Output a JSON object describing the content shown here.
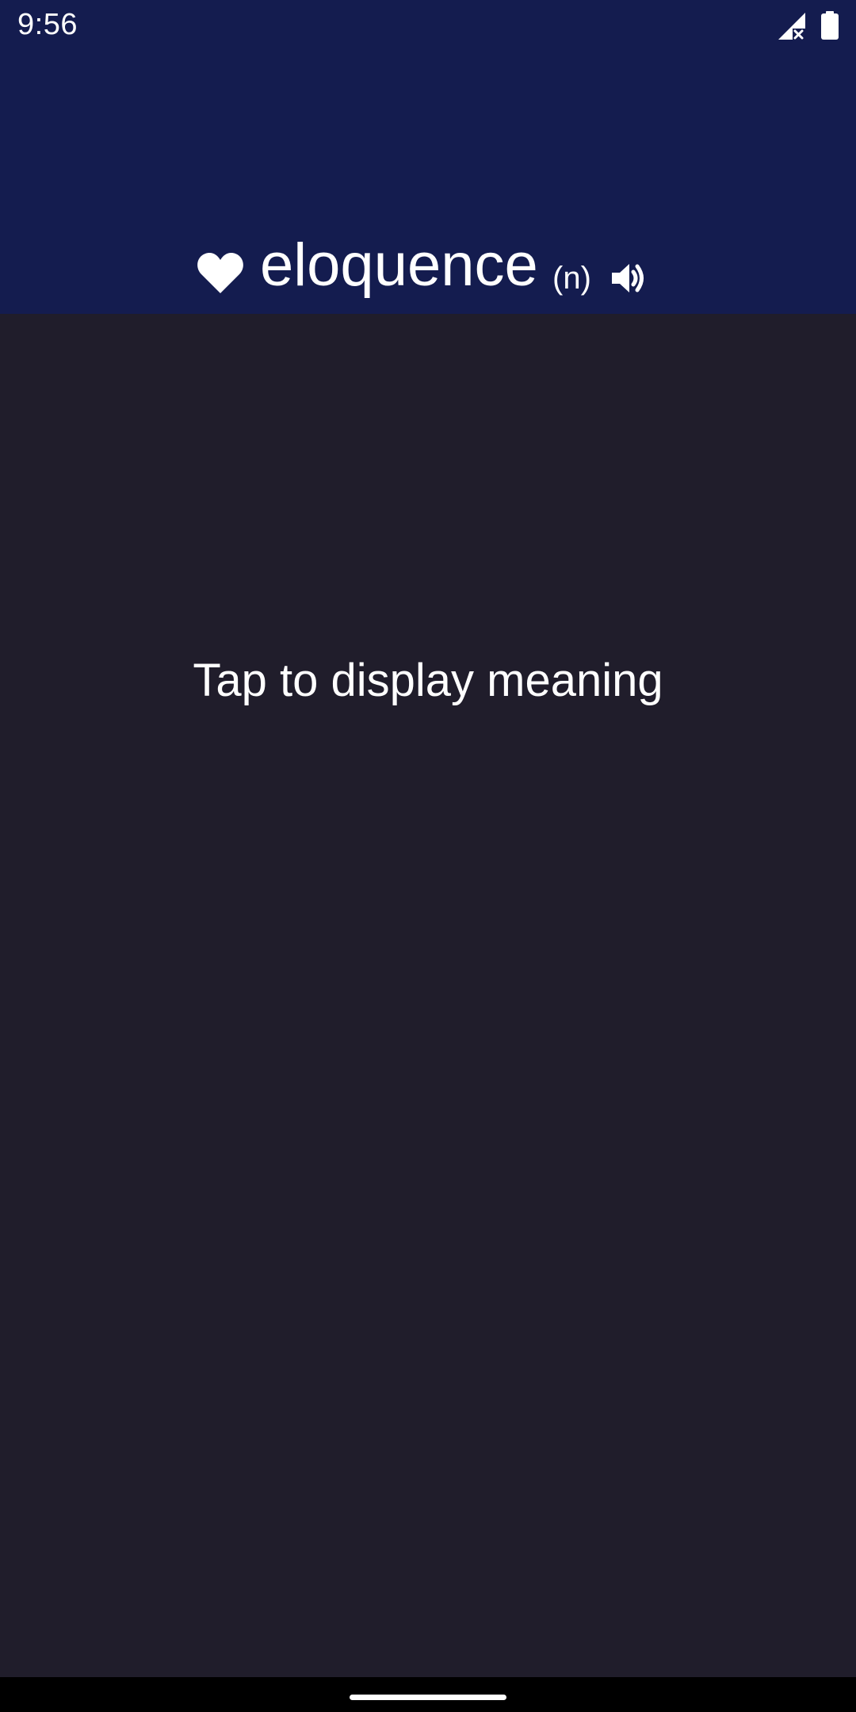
{
  "status_bar": {
    "time": "9:56",
    "signal_icon": "signal-no-service-icon",
    "battery_icon": "battery-full-icon"
  },
  "word_card": {
    "favorite_icon": "heart-icon",
    "word": "eloquence",
    "part_of_speech": "(n)",
    "audio_icon": "speaker-icon"
  },
  "meaning": {
    "prompt": "Tap to display meaning"
  },
  "colors": {
    "header_bg": "#141c4f",
    "body_bg": "#201d2b",
    "text": "#ffffff",
    "nav_bg": "#000000"
  }
}
